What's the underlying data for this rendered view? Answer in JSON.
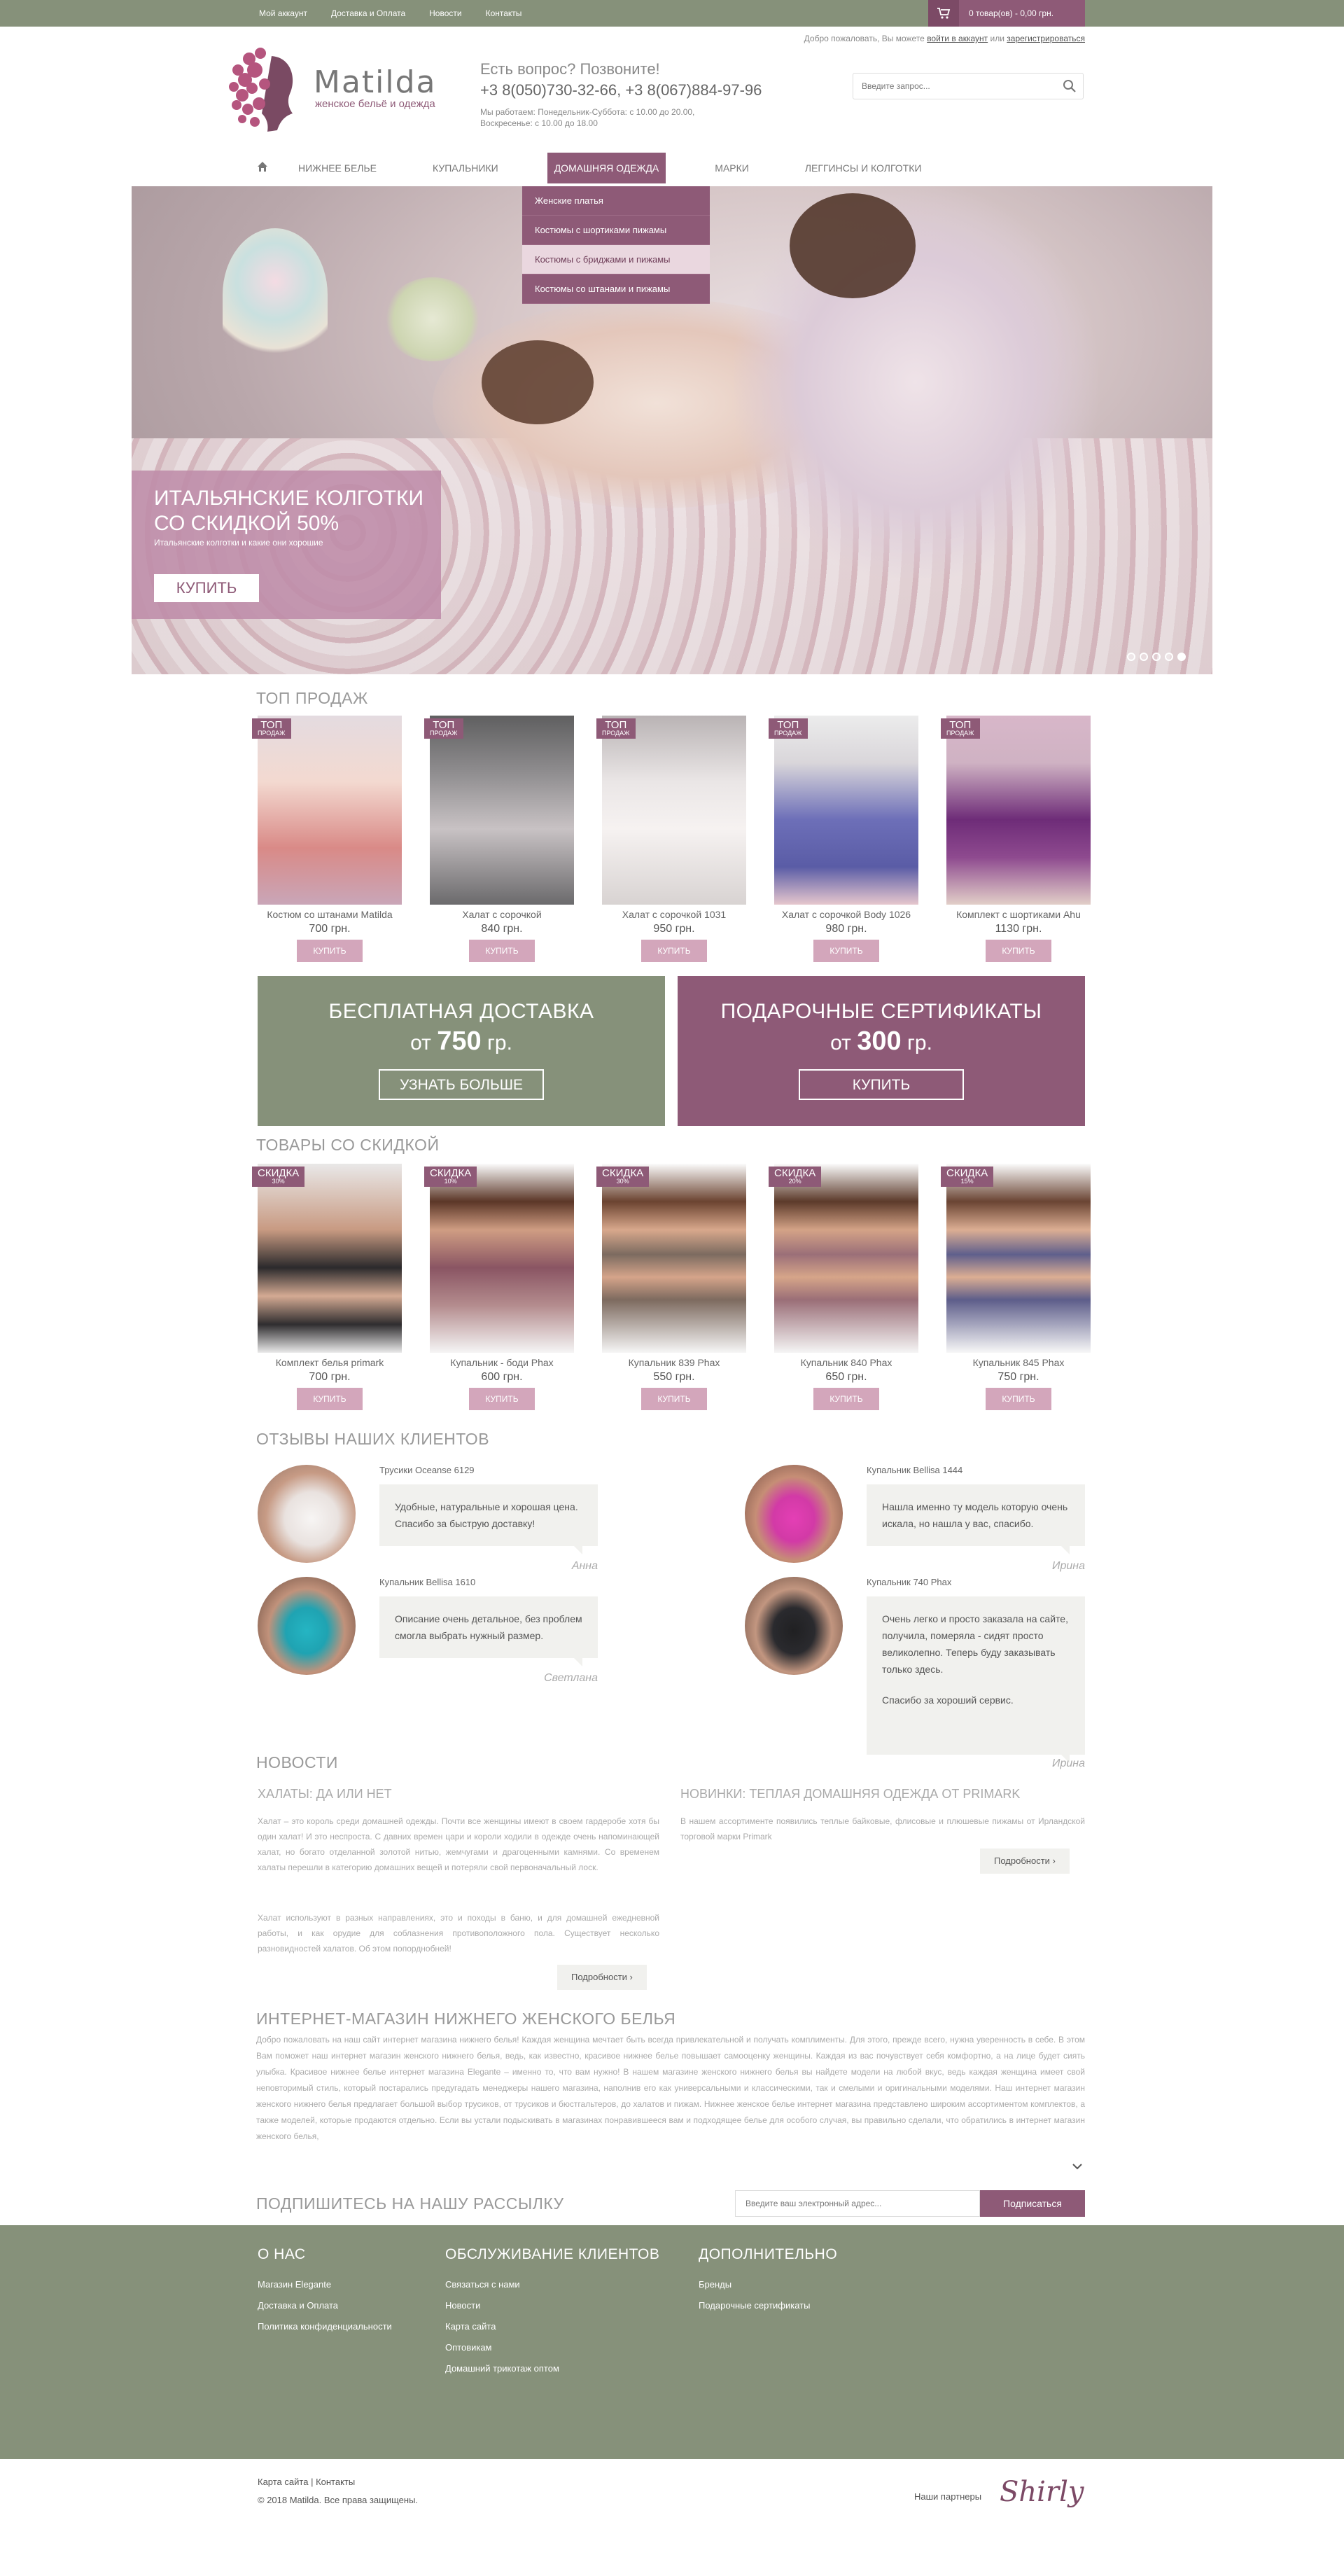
{
  "topbar": {
    "links": [
      "Мой аккаунт",
      "Доставка и Оплата",
      "Новости",
      "Контакты"
    ],
    "cart_text": "0 товар(ов) - 0,00 грн."
  },
  "welcome": {
    "text": "Добро пожаловать, Вы можете",
    "login": "войти в аккаунт",
    "or": "или",
    "register": "зарегистрироваться"
  },
  "header": {
    "brand": "Matilda",
    "subtitle": "женское бельё и одежда",
    "call_question": "Есть вопрос? Позвоните!",
    "phones": "+3 8(050)730-32-66, +3 8(067)884-97-96",
    "hours_1": "Мы работаем: Понедельник-Суббота: с 10.00 до 20.00,",
    "hours_2": "Воскресенье: с 10.00 до 18.00",
    "search_placeholder": "Введите запрос..."
  },
  "nav": {
    "items": [
      "НИЖНЕЕ БЕЛЬЕ",
      "КУПАЛЬНИКИ",
      "ДОМАШНЯЯ ОДЕЖДА",
      "МАРКИ",
      "ЛЕГГИНСЫ И КОЛГОТКИ"
    ],
    "dropdown": [
      "Женские платья",
      "Костюмы с шортиками пижамы",
      "Костюмы с бриджами и пижамы",
      "Костюмы со штанами и пижамы"
    ]
  },
  "hero": {
    "title_1": "ИТАЛЬЯНСКИЕ КОЛГОТКИ",
    "title_2": "СО СКИДКОЙ 50%",
    "subtitle": "Итальянские колготки и какие они хорошие",
    "button": "КУПИТЬ",
    "slides_total": 5,
    "slide_active": 5
  },
  "top_sales": {
    "title": "ТОП ПРОДАЖ",
    "badge_main": "ТОП",
    "badge_sub": "ПРОДАЖ",
    "button": "КУПИТЬ",
    "items": [
      {
        "name": "Костюм со штанами Matilda",
        "price": "700 грн."
      },
      {
        "name": "Халат с сорочкой",
        "price": "840 грн."
      },
      {
        "name": "Халат с сорочкой 1031",
        "price": "950 грн."
      },
      {
        "name": "Халат с сорочкой Body 1026",
        "price": "980 грн."
      },
      {
        "name": "Комплект с шортиками Ahu",
        "price": "1130 грн."
      }
    ]
  },
  "banners": {
    "delivery_title": "БЕСПЛАТНАЯ ДОСТАВКА",
    "delivery_from": "от",
    "delivery_amount": "750",
    "delivery_currency": "гр.",
    "delivery_button": "УЗНАТЬ БОЛЬШЕ",
    "gift_title": "ПОДАРОЧНЫЕ СЕРТИФИКАТЫ",
    "gift_from": "от",
    "gift_amount": "300",
    "gift_currency": "гр.",
    "gift_button": "КУПИТЬ"
  },
  "discounts": {
    "title": "ТОВАРЫ СО СКИДКОЙ",
    "badge_main": "СКИДКА",
    "button": "КУПИТЬ",
    "items": [
      {
        "name": "Комплект белья primark",
        "price": "700 грн.",
        "discount": "30%"
      },
      {
        "name": "Купальник - боди Phax",
        "price": "600 грн.",
        "discount": "10%"
      },
      {
        "name": "Купальник 839 Phax",
        "price": "550 грн.",
        "discount": "30%"
      },
      {
        "name": "Купальник 840 Phax",
        "price": "650 грн.",
        "discount": "20%"
      },
      {
        "name": "Купальник 845 Phax",
        "price": "750 грн.",
        "discount": "15%"
      }
    ]
  },
  "reviews": {
    "title": "ОТЗЫВЫ НАШИХ КЛИЕНТОВ",
    "items": [
      {
        "product": "Трусики Oceanse 6129",
        "text": "Удобные, натуральные и хорошая цена. Спасибо за быструю доставку!",
        "author": "Анна"
      },
      {
        "product": "Купальник Bellisa 1444",
        "text": "Нашла именно ту модель которую очень искала, но нашла у вас, спасибо.",
        "author": "Ирина"
      },
      {
        "product": "Купальник Bellisa 1610",
        "text": "Описание очень детальное, без проблем смогла выбрать нужный размер.",
        "author": "Светлана"
      },
      {
        "product": "Купальник 740 Phax",
        "text": "Очень легко и просто заказала на сайте, получила, померяла - сидят просто великолепно. Теперь буду заказывать только здесь.",
        "text2": "Спасибо за хороший сервис.",
        "author": "Ирина"
      }
    ]
  },
  "news": {
    "title": "НОВОСТИ",
    "more": "Подробности",
    "items": [
      {
        "heading": "ХАЛАТЫ: ДА ИЛИ НЕТ",
        "p1": "Халат – это король среди домашней одежды. Почти все женщины имеют в своем гардеробе хотя бы один халат! И это неспроста. С давних времен цари и короли ходили в одежде очень напоминающей халат, но богато отделанной золотой нитью, жемчугами и драгоценными камнями. Со временем халаты перешли в категорию домашних вещей и потеряли свой первоначальный лоск.",
        "p2": "Халат используют в разных направлениях, это и походы в баню, и для домашней ежедневной работы, и как орудие для соблазнения противоположного пола. Существует несколько разновидностей халатов. Об этом попорднобней!"
      },
      {
        "heading": "НОВИНКИ: ТЕПЛАЯ ДОМАШНЯЯ ОДЕЖДА ОТ PRIMARK",
        "p1": "В нашем ассортименте появились теплые байковые, флисовые и плюшевые пижамы от Ирландской торговой марки Primark"
      }
    ]
  },
  "seo": {
    "title": "ИНТЕРНЕТ-МАГАЗИН НИЖНЕГО ЖЕНСКОГО БЕЛЬЯ",
    "text": " Добро пожаловать на наш сайт интернет магазина нижнего белья! Каждая женщина мечтает быть всегда привлекательной и получать комплименты. Для этого, прежде всего, нужна уверенность в себе. В этом Вам поможет наш интернет магазин женского нижнего белья, ведь, как известно, красивое нижнее белье повышает самооценку женщины. Каждая из вас почувствует себя комфортно, а на лице будет сиять улыбка. Красивое нижнее белье интернет магазина Elegante – именно то, что вам нужно! В нашем магазине женского нижнего белья вы найдете модели на любой вкус, ведь каждая женщина имеет свой неповторимый стиль, который постарались предугадать менеджеры нашего магазина, наполнив его как универсальными и классическими, так и смелыми и оригинальными моделями. Наш интернет магазин женского нижнего белья предлагает большой выбор трусиков, от трусиков и бюстгальтеров, до халатов и пижам. Нижнее женское белье интернет магазина представлено широким ассортиментом комплектов, а также моделей, которые продаются отдельно. Если вы устали подыскивать в магазинах понравившееся вам и подходящее белье для особого случая, вы правильно сделали, что обратились в интернет магазин женского белья,"
  },
  "subscribe": {
    "title": "ПОДПИШИТЕСЬ НА НАШУ РАССЫЛКУ",
    "placeholder": "Введите ваш электронный адрес...",
    "button": "Подписаться"
  },
  "footer": {
    "about_title": "О НАС",
    "about": [
      "Магазин Elegante",
      "Доставка и Оплата",
      "Политика конфиденциальности"
    ],
    "service_title": "ОБСЛУЖИВАНИЕ КЛИЕНТОВ",
    "service": [
      "Связаться с нами",
      "Новости",
      "Карта сайта",
      "Оптовикам",
      "Домашний трикотаж оптом"
    ],
    "extra_title": "ДОПОЛНИТЕЛЬНО",
    "extra": [
      "Бренды",
      "Подарочные сертификаты"
    ],
    "sitemap": "Карта сайта",
    "contacts": "Контакты",
    "copyright": "© 2018 Matilda. Все права защищены.",
    "partners": "Наши партнеры",
    "partner_logo": "Shirly"
  },
  "colors": {
    "olive": "#86917a",
    "plum": "#8e5a77",
    "pink": "#d3a6bb"
  }
}
